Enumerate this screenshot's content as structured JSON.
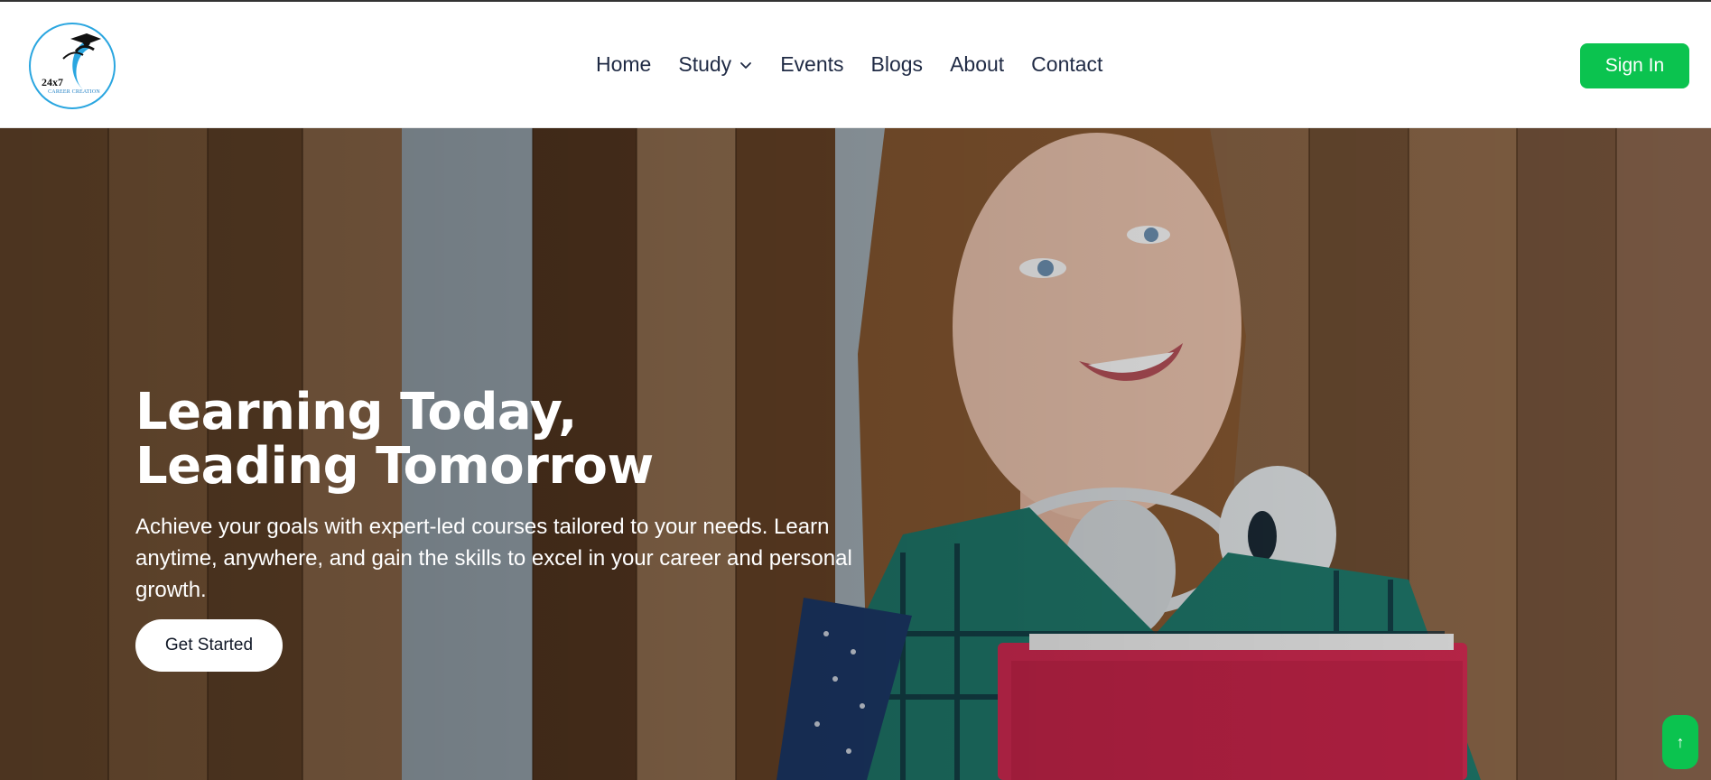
{
  "brand": {
    "logo_main": "24x7",
    "logo_sub": "CAREER CREATION"
  },
  "nav": {
    "items": [
      {
        "label": "Home"
      },
      {
        "label": "Study",
        "has_dropdown": true
      },
      {
        "label": "Events"
      },
      {
        "label": "Blogs"
      },
      {
        "label": "About"
      },
      {
        "label": "Contact"
      }
    ],
    "signin_label": "Sign In"
  },
  "hero": {
    "title_line1": "Learning Today,",
    "title_line2": "Leading Tomorrow",
    "description": "Achieve your goals with expert-led courses tailored to your needs. Learn anytime, anywhere, and gain the skills to excel in your career and personal growth.",
    "cta_label": "Get Started"
  },
  "scroll_top": {
    "icon": "arrow-up-icon",
    "label": "↑"
  },
  "colors": {
    "accent": "#0bc34f",
    "nav_text": "#1f2a44",
    "logo_ring": "#2aa6e0"
  }
}
